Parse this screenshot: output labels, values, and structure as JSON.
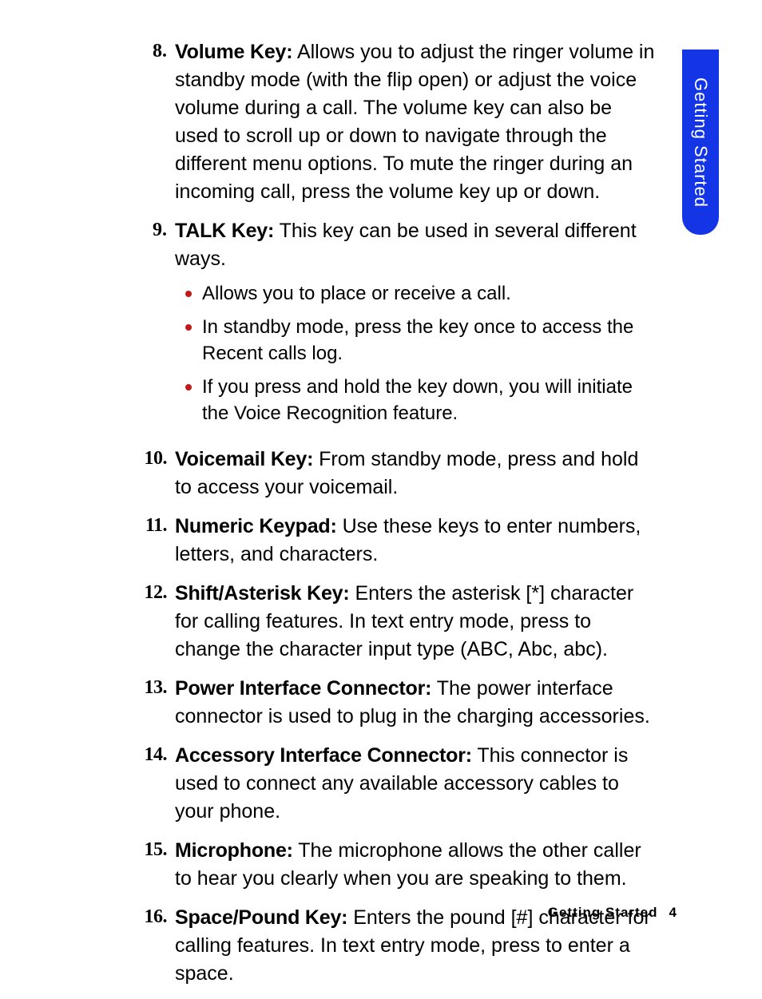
{
  "sideTab": "Getting Started",
  "items": [
    {
      "n": "8.",
      "term": "Volume Key:",
      "desc": " Allows you to adjust the ringer volume in standby mode (with the flip open) or adjust the voice volume during a call. The volume key can also be used to scroll up or down to navigate through the different menu options. To mute the ringer during an incoming call, press the volume key up or down."
    },
    {
      "n": "9.",
      "term": "TALK Key:",
      "desc": " This key can be used in several different ways.",
      "subs": [
        "Allows you to place or receive a call.",
        "In standby mode, press the key once to access the Recent calls log.",
        "If you press and hold the key down, you will initiate the Voice Recognition feature."
      ]
    },
    {
      "n": "10.",
      "term": "Voicemail Key:",
      "desc": " From standby mode, press and hold to access your voicemail."
    },
    {
      "n": "11.",
      "term": "Numeric Keypad:",
      "desc": " Use these keys to enter numbers, letters, and characters."
    },
    {
      "n": "12.",
      "term": "Shift/Asterisk Key:",
      "desc": " Enters the asterisk [*] character for calling features. In text entry mode, press to change the character input type (ABC, Abc, abc)."
    },
    {
      "n": "13.",
      "term": "Power Interface Connector:",
      "desc": " The power interface connector is used to plug in the charging accessories."
    },
    {
      "n": "14.",
      "term": "Accessory Interface Connector:",
      "desc": " This connector is used to connect any available accessory cables to your phone."
    },
    {
      "n": "15.",
      "term": "Microphone:",
      "desc": " The microphone allows the other caller to hear you clearly when you are speaking to them."
    },
    {
      "n": "16.",
      "term": "Space/Pound Key:",
      "desc": " Enters the pound [#] character for calling features. In text entry mode, press to enter a space."
    }
  ],
  "footer": {
    "section": "Getting Started",
    "page": "4"
  }
}
